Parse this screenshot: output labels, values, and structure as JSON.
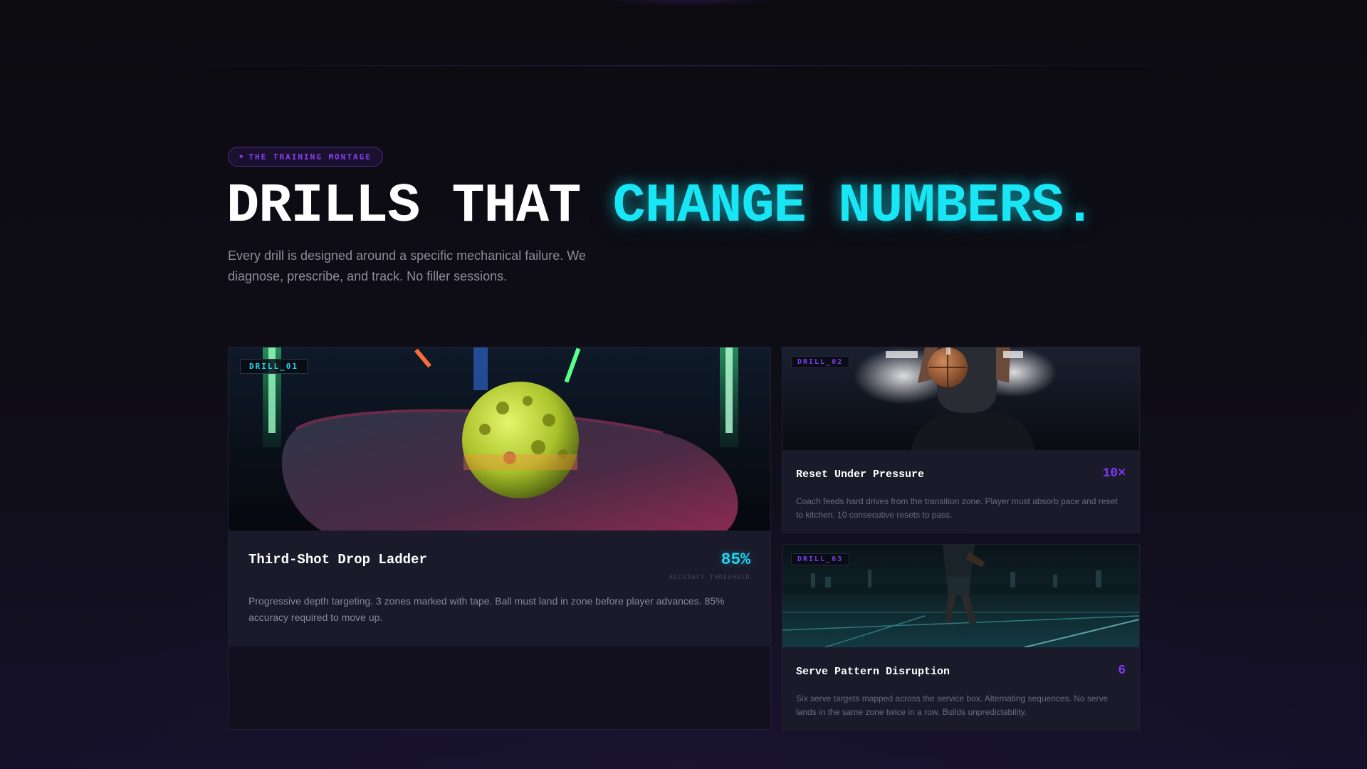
{
  "section": {
    "tag": "THE TRAINING MONTAGE",
    "tag_icon": "sparkle-icon",
    "headline_plain": "DRILLS THAT ",
    "headline_accent": "CHANGE NUMBERS.",
    "intro": "Every drill is designed around a specific mechanical failure. We diagnose, prescribe, and track. No filler sessions."
  },
  "colors": {
    "accent_cyan": "#22d3ee",
    "accent_purple": "#7c3aed",
    "background": "#0d0c12",
    "card": "#1b1a2b"
  },
  "drills": [
    {
      "id": "DRILL_01",
      "title": "Third-Shot Drop Ladder",
      "metric": "85%",
      "metric_caption": "ACCURACY THRESHOLD",
      "description": "Progressive depth targeting. 3 zones marked with tape. Ball must land in zone before player advances. 85% accuracy required to move up.",
      "image": "pickleball-paddle-ball-image"
    },
    {
      "id": "DRILL_02",
      "title": "Reset Under Pressure",
      "metric": "10×",
      "description": "Coach feeds hard drives from the transition zone. Player must absorb pace and reset to kitchen. 10 consecutive resets to pass.",
      "image": "athlete-holding-ball-image"
    },
    {
      "id": "DRILL_03",
      "title": "Serve Pattern Disruption",
      "metric": "6",
      "description": "Six serve targets mapped across the service box. Alternating sequences. No serve lands in the same zone twice in a row. Builds unpredictability.",
      "image": "athlete-on-court-night-image"
    }
  ]
}
